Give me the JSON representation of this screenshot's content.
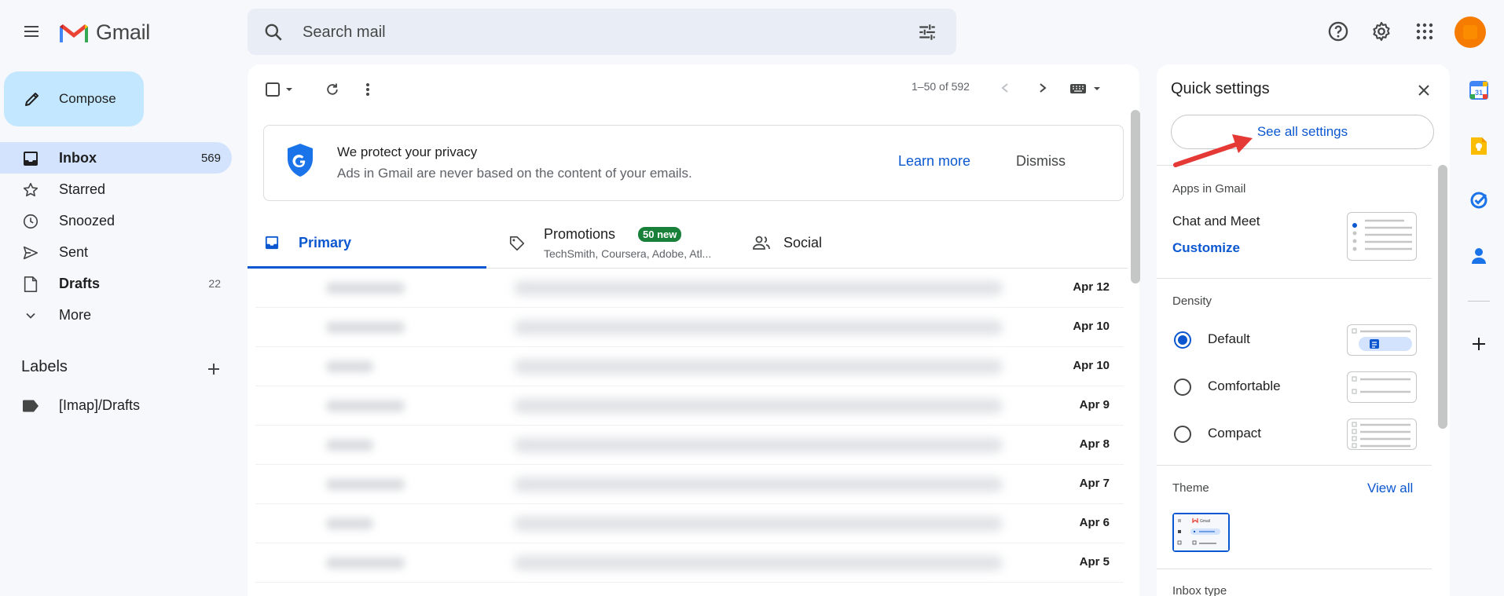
{
  "app": {
    "name": "Gmail"
  },
  "search": {
    "placeholder": "Search mail"
  },
  "compose": {
    "label": "Compose"
  },
  "nav": [
    {
      "label": "Inbox",
      "count": "569",
      "icon": "inbox-icon",
      "active": true
    },
    {
      "label": "Starred",
      "count": "",
      "icon": "star-icon"
    },
    {
      "label": "Snoozed",
      "count": "",
      "icon": "clock-icon"
    },
    {
      "label": "Sent",
      "count": "",
      "icon": "send-icon"
    },
    {
      "label": "Drafts",
      "count": "22",
      "icon": "draft-icon"
    },
    {
      "label": "More",
      "count": "",
      "icon": "chevron-down-icon"
    }
  ],
  "labels": {
    "heading": "Labels",
    "items": [
      "[Imap]/Drafts"
    ]
  },
  "toolbar": {
    "page_range": "1–50 of 592"
  },
  "privacy_banner": {
    "title": "We protect your privacy",
    "subtitle": "Ads in Gmail are never based on the content of your emails.",
    "learn_more": "Learn more",
    "dismiss": "Dismiss"
  },
  "tabs": {
    "primary": "Primary",
    "promotions": "Promotions",
    "promotions_badge": "50 new",
    "promotions_senders": "TechSmith, Coursera, Adobe, Atl...",
    "social": "Social"
  },
  "emails": [
    {
      "date": "Apr 12"
    },
    {
      "date": "Apr 10"
    },
    {
      "date": "Apr 10"
    },
    {
      "date": "Apr 9"
    },
    {
      "date": "Apr 8"
    },
    {
      "date": "Apr 7"
    },
    {
      "date": "Apr 6"
    },
    {
      "date": "Apr 5"
    }
  ],
  "quick_settings": {
    "title": "Quick settings",
    "see_all": "See all settings",
    "apps_heading": "Apps in Gmail",
    "chat_meet": "Chat and Meet",
    "customize": "Customize",
    "density_heading": "Density",
    "density_options": [
      "Default",
      "Comfortable",
      "Compact"
    ],
    "density_selected": "Default",
    "theme_heading": "Theme",
    "view_all": "View all",
    "theme_thumb_label": "Gmail",
    "inbox_type_heading": "Inbox type"
  },
  "side_apps": [
    "calendar-icon",
    "keep-icon",
    "tasks-icon",
    "contacts-icon",
    "add-icon"
  ],
  "colors": {
    "accent": "#0b57d0",
    "compose_bg": "#c2e7ff",
    "active_nav": "#d3e3fd",
    "badge_green": "#188038",
    "annotation_arrow": "#e53935"
  }
}
